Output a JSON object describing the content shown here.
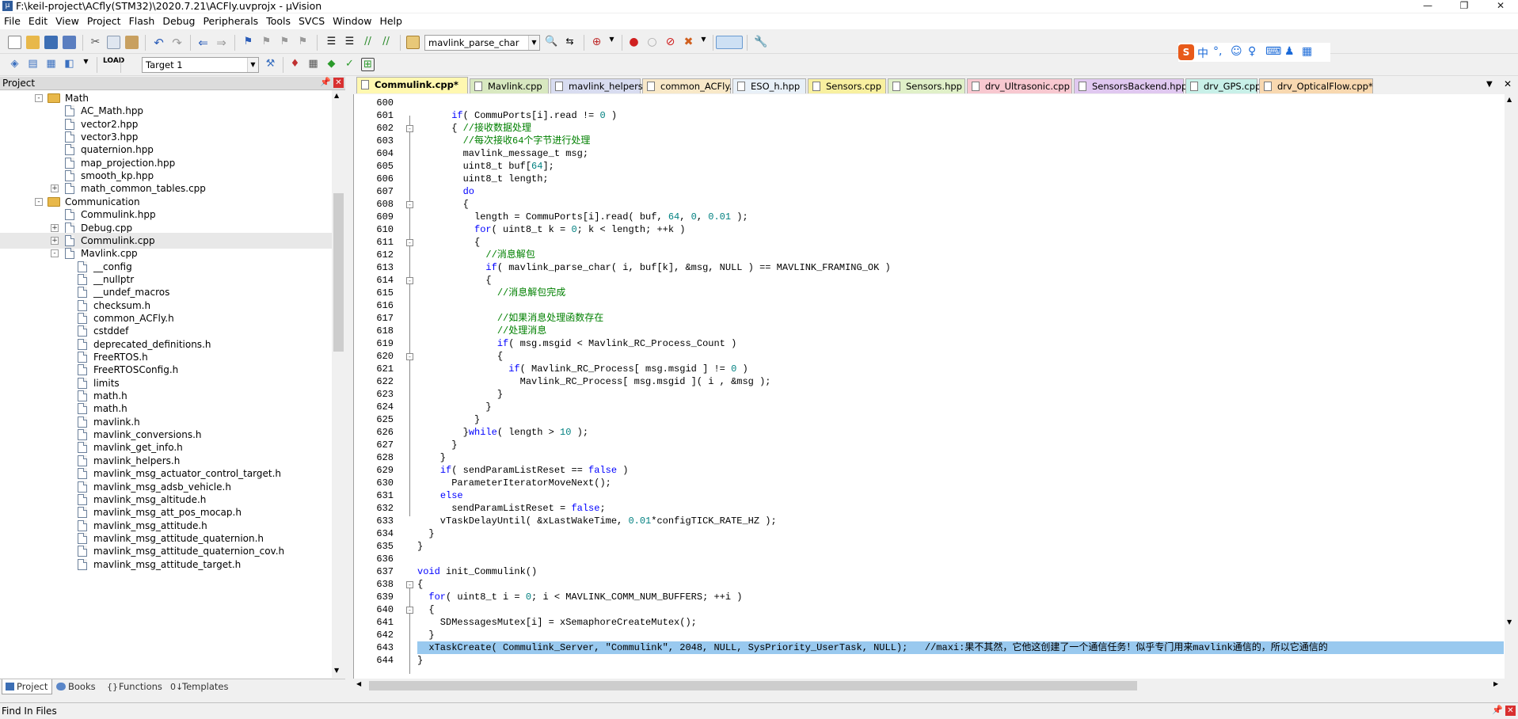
{
  "window": {
    "title": "F:\\keil-project\\ACfly(STM32)\\2020.7.21\\ACFly.uvprojx - µVision"
  },
  "menu": [
    "File",
    "Edit",
    "View",
    "Project",
    "Flash",
    "Debug",
    "Peripherals",
    "Tools",
    "SVCS",
    "Window",
    "Help"
  ],
  "toolbar": {
    "find_combo": "mavlink_parse_char",
    "target_combo": "Target 1"
  },
  "ime": {
    "label": "中"
  },
  "project": {
    "title": "Project",
    "tree": [
      {
        "label": "Math",
        "type": "folder",
        "exp": "-"
      },
      {
        "label": "AC_Math.hpp",
        "type": "file"
      },
      {
        "label": "vector2.hpp",
        "type": "file"
      },
      {
        "label": "vector3.hpp",
        "type": "file"
      },
      {
        "label": "quaternion.hpp",
        "type": "file"
      },
      {
        "label": "map_projection.hpp",
        "type": "file"
      },
      {
        "label": "smooth_kp.hpp",
        "type": "file"
      },
      {
        "label": "math_common_tables.cpp",
        "type": "file",
        "exp": "+"
      },
      {
        "label": "Communication",
        "type": "folder",
        "exp": "-"
      },
      {
        "label": "Commulink.hpp",
        "type": "file"
      },
      {
        "label": "Debug.cpp",
        "type": "file",
        "exp": "+"
      },
      {
        "label": "Commulink.cpp",
        "type": "file",
        "exp": "+",
        "selected": true
      },
      {
        "label": "Mavlink.cpp",
        "type": "file",
        "exp": "-"
      },
      {
        "label": "__config",
        "type": "file",
        "child": true
      },
      {
        "label": "__nullptr",
        "type": "file",
        "child": true
      },
      {
        "label": "__undef_macros",
        "type": "file",
        "child": true
      },
      {
        "label": "checksum.h",
        "type": "file",
        "child": true
      },
      {
        "label": "common_ACFly.h",
        "type": "file",
        "child": true
      },
      {
        "label": "cstddef",
        "type": "file",
        "child": true
      },
      {
        "label": "deprecated_definitions.h",
        "type": "file",
        "child": true
      },
      {
        "label": "FreeRTOS.h",
        "type": "file",
        "child": true
      },
      {
        "label": "FreeRTOSConfig.h",
        "type": "file",
        "child": true
      },
      {
        "label": "limits",
        "type": "file",
        "child": true
      },
      {
        "label": "math.h",
        "type": "file",
        "child": true
      },
      {
        "label": "math.h",
        "type": "file",
        "child": true
      },
      {
        "label": "mavlink.h",
        "type": "file",
        "child": true
      },
      {
        "label": "mavlink_conversions.h",
        "type": "file",
        "child": true
      },
      {
        "label": "mavlink_get_info.h",
        "type": "file",
        "child": true
      },
      {
        "label": "mavlink_helpers.h",
        "type": "file",
        "child": true
      },
      {
        "label": "mavlink_msg_actuator_control_target.h",
        "type": "file",
        "child": true
      },
      {
        "label": "mavlink_msg_adsb_vehicle.h",
        "type": "file",
        "child": true
      },
      {
        "label": "mavlink_msg_altitude.h",
        "type": "file",
        "child": true
      },
      {
        "label": "mavlink_msg_att_pos_mocap.h",
        "type": "file",
        "child": true
      },
      {
        "label": "mavlink_msg_attitude.h",
        "type": "file",
        "child": true
      },
      {
        "label": "mavlink_msg_attitude_quaternion.h",
        "type": "file",
        "child": true
      },
      {
        "label": "mavlink_msg_attitude_quaternion_cov.h",
        "type": "file",
        "child": true
      },
      {
        "label": "mavlink_msg_attitude_target.h",
        "type": "file",
        "child": true
      }
    ],
    "bottom_tabs": [
      "Project",
      "Books",
      "Functions",
      "Templates"
    ]
  },
  "editor_tabs": [
    {
      "label": "Commulink.cpp*",
      "color": "#fff8b0",
      "active": true
    },
    {
      "label": "Mavlink.cpp",
      "color": "#d8e8c0"
    },
    {
      "label": "mavlink_helpers.h",
      "color": "#d8dcf0"
    },
    {
      "label": "common_ACFly.h",
      "color": "#f8e8c8"
    },
    {
      "label": "ESO_h.hpp",
      "color": "#e8f0f8"
    },
    {
      "label": "Sensors.cpp",
      "color": "#f8f0a0"
    },
    {
      "label": "Sensors.hpp",
      "color": "#e0f0c8"
    },
    {
      "label": "drv_Ultrasonic.cpp",
      "color": "#f8c8d0"
    },
    {
      "label": "SensorsBackend.hpp",
      "color": "#e0c8f0"
    },
    {
      "label": "drv_GPS.cpp",
      "color": "#c8f0e8"
    },
    {
      "label": "drv_OpticalFlow.cpp*",
      "color": "#f8d8b0"
    }
  ],
  "code": [
    {
      "n": "600",
      "t": ""
    },
    {
      "n": "601",
      "t": "      <span class=kw>if</span>( CommuPorts[i].read != <span class=num>0</span> )"
    },
    {
      "n": "602",
      "t": "      { <span class=cm>//接收数据处理</span>",
      "fold": "-"
    },
    {
      "n": "603",
      "t": "        <span class=cm>//每次接收64个字节进行处理</span>"
    },
    {
      "n": "604",
      "t": "        mavlink_message_t msg;"
    },
    {
      "n": "605",
      "t": "        uint8_t buf[<span class=num>64</span>];"
    },
    {
      "n": "606",
      "t": "        uint8_t length;"
    },
    {
      "n": "607",
      "t": "        <span class=kw>do</span>"
    },
    {
      "n": "608",
      "t": "        {",
      "fold": "-"
    },
    {
      "n": "609",
      "t": "          length = CommuPorts[i].read( buf, <span class=num>64</span>, <span class=num>0</span>, <span class=num>0.01</span> );"
    },
    {
      "n": "610",
      "t": "          <span class=kw>for</span>( uint8_t k = <span class=num>0</span>; k &lt; length; ++k )"
    },
    {
      "n": "611",
      "t": "          {",
      "fold": "-"
    },
    {
      "n": "612",
      "t": "            <span class=cm>//消息解包</span>"
    },
    {
      "n": "613",
      "t": "            <span class=kw>if</span>( mavlink_parse_char( i, buf[k], &amp;msg, NULL ) == MAVLINK_FRAMING_OK )"
    },
    {
      "n": "614",
      "t": "            {",
      "fold": "-"
    },
    {
      "n": "615",
      "t": "              <span class=cm>//消息解包完成</span>"
    },
    {
      "n": "616",
      "t": ""
    },
    {
      "n": "617",
      "t": "              <span class=cm>//如果消息处理函数存在</span>"
    },
    {
      "n": "618",
      "t": "              <span class=cm>//处理消息</span>"
    },
    {
      "n": "619",
      "t": "              <span class=kw>if</span>( msg.msgid &lt; Mavlink_RC_Process_Count )"
    },
    {
      "n": "620",
      "t": "              {",
      "fold": "-"
    },
    {
      "n": "621",
      "t": "                <span class=kw>if</span>( Mavlink_RC_Process[ msg.msgid ] != <span class=num>0</span> )"
    },
    {
      "n": "622",
      "t": "                  Mavlink_RC_Process[ msg.msgid ]( i , &amp;msg );"
    },
    {
      "n": "623",
      "t": "              }"
    },
    {
      "n": "624",
      "t": "            }"
    },
    {
      "n": "625",
      "t": "          }"
    },
    {
      "n": "626",
      "t": "        }<span class=kw>while</span>( length &gt; <span class=num>10</span> );"
    },
    {
      "n": "627",
      "t": "      }"
    },
    {
      "n": "628",
      "t": "    }"
    },
    {
      "n": "629",
      "t": "    <span class=kw>if</span>( sendParamListReset == <span class=kw>false</span> )"
    },
    {
      "n": "630",
      "t": "      ParameterIteratorMoveNext();"
    },
    {
      "n": "631",
      "t": "    <span class=kw>else</span>"
    },
    {
      "n": "632",
      "t": "      sendParamListReset = <span class=kw>false</span>;"
    },
    {
      "n": "633",
      "t": "    vTaskDelayUntil( &amp;xLastWakeTime, <span class=num>0.01</span>*configTICK_RATE_HZ );"
    },
    {
      "n": "634",
      "t": "  }"
    },
    {
      "n": "635",
      "t": "}"
    },
    {
      "n": "636",
      "t": ""
    },
    {
      "n": "637",
      "t": "<span class=kw>void</span> init_Commulink()"
    },
    {
      "n": "638",
      "t": "{",
      "fold": "-"
    },
    {
      "n": "639",
      "t": "  <span class=kw>for</span>( uint8_t i = <span class=num>0</span>; i &lt; MAVLINK_COMM_NUM_BUFFERS; ++i )"
    },
    {
      "n": "640",
      "t": "  {",
      "fold": "-"
    },
    {
      "n": "641",
      "t": "    SDMessagesMutex[i] = xSemaphoreCreateMutex();"
    },
    {
      "n": "642",
      "t": "  }"
    },
    {
      "n": "643",
      "t": "  xTaskCreate( Commulink_Server, \"Commulink\", 2048, NULL, SysPriority_UserTask, NULL);   //maxi:果不其然，它他这创建了一个通信任务！似乎专门用来mavlink通信的，所以它通信的",
      "hl": true
    },
    {
      "n": "644",
      "t": "}"
    }
  ],
  "find_panel": {
    "title": "Find In Files"
  }
}
